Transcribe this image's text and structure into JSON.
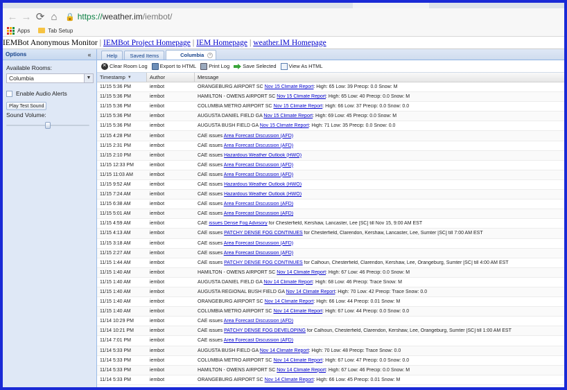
{
  "browser": {
    "url_scheme": "https://",
    "url_host": "weather.im",
    "url_path": "/iembot/",
    "bookmarks": [
      "Apps",
      "Tab Setup"
    ]
  },
  "header": {
    "title": "IEMBot Anonymous Monitor",
    "links": [
      "IEMBot Project Homepage",
      "IEM Homepage",
      "weather.IM Homepage"
    ]
  },
  "options": {
    "title": "Options",
    "rooms_label": "Available Rooms:",
    "selected_room": "Columbia",
    "audio_label": "Enable Audio Alerts",
    "test_sound_label": "Play Test Sound",
    "volume_label": "Sound Volume:",
    "volume_level": 0.5
  },
  "tabs": [
    "Help",
    "Saved Items",
    "Columbia"
  ],
  "actions": {
    "clear": "Clear Room Log",
    "export": "Export to HTML",
    "print": "Print Log",
    "save": "Save Selected",
    "view": "View As HTML"
  },
  "columns": {
    "timestamp": "Timestamp",
    "author": "Author",
    "message": "Message"
  },
  "rows": [
    {
      "ts": "11/15 5:36 PM",
      "author": "iembot",
      "pre": "ORANGEBURG AIRPORT SC ",
      "link": "Nov 15 Climate Report",
      "post": ": High: 65 Low: 39 Precip: 0.0 Snow: M"
    },
    {
      "ts": "11/15 5:36 PM",
      "author": "iembot",
      "pre": "HAMILTON - OWENS AIRPORT SC ",
      "link": "Nov 15 Climate Report",
      "post": ": High: 65 Low: 40 Precip: 0.0 Snow: M"
    },
    {
      "ts": "11/15 5:36 PM",
      "author": "iembot",
      "pre": "COLUMBIA METRO AIRPORT SC ",
      "link": "Nov 15 Climate Report",
      "post": ": High: 66 Low: 37 Precip: 0.0 Snow: 0.0"
    },
    {
      "ts": "11/15 5:36 PM",
      "author": "iembot",
      "pre": "AUGUSTA DANIEL FIELD GA ",
      "link": "Nov 15 Climate Report",
      "post": ": High: 69 Low: 45 Precip: 0.0 Snow: M"
    },
    {
      "ts": "11/15 5:36 PM",
      "author": "iembot",
      "pre": "AUGUSTA BUSH FIELD GA ",
      "link": "Nov 15 Climate Report",
      "post": ": High: 71 Low: 35 Precip: 0.0 Snow: 0.0"
    },
    {
      "ts": "11/15 4:28 PM",
      "author": "iembot",
      "pre": "CAE issues ",
      "link": "Area Forecast Discussion (AFD)",
      "post": ""
    },
    {
      "ts": "11/15 2:31 PM",
      "author": "iembot",
      "pre": "CAE issues ",
      "link": "Area Forecast Discussion (AFD)",
      "post": ""
    },
    {
      "ts": "11/15 2:10 PM",
      "author": "iembot",
      "pre": "CAE issues ",
      "link": "Hazardous Weather Outlook (HWO)",
      "post": ""
    },
    {
      "ts": "11/15 12:33 PM",
      "author": "iembot",
      "pre": "CAE issues ",
      "link": "Area Forecast Discussion (AFD)",
      "post": ""
    },
    {
      "ts": "11/15 11:03 AM",
      "author": "iembot",
      "pre": "CAE issues ",
      "link": "Area Forecast Discussion (AFD)",
      "post": ""
    },
    {
      "ts": "11/15 9:52 AM",
      "author": "iembot",
      "pre": "CAE issues ",
      "link": "Hazardous Weather Outlook (HWO)",
      "post": ""
    },
    {
      "ts": "11/15 7:24 AM",
      "author": "iembot",
      "pre": "CAE issues ",
      "link": "Hazardous Weather Outlook (HWO)",
      "post": ""
    },
    {
      "ts": "11/15 6:38 AM",
      "author": "iembot",
      "pre": "CAE issues ",
      "link": "Area Forecast Discussion (AFD)",
      "post": ""
    },
    {
      "ts": "11/15 5:01 AM",
      "author": "iembot",
      "pre": "CAE issues ",
      "link": "Area Forecast Discussion (AFD)",
      "post": ""
    },
    {
      "ts": "11/15 4:59 AM",
      "author": "iembot",
      "pre": "CAE ",
      "link": "issues Dense Fog Advisory",
      "post": " for Chesterfield, Kershaw, Lancaster, Lee [SC] till Nov 15, 9:00 AM EST"
    },
    {
      "ts": "11/15 4:13 AM",
      "author": "iembot",
      "pre": "CAE issues ",
      "link": "PATCHY DENSE FOG CONTINUES",
      "post": " for Chesterfield, Clarendon, Kershaw, Lancaster, Lee, Sumter [SC] till 7:00 AM EST"
    },
    {
      "ts": "11/15 3:18 AM",
      "author": "iembot",
      "pre": "CAE issues ",
      "link": "Area Forecast Discussion (AFD)",
      "post": ""
    },
    {
      "ts": "11/15 2:27 AM",
      "author": "iembot",
      "pre": "CAE issues ",
      "link": "Area Forecast Discussion (AFD)",
      "post": ""
    },
    {
      "ts": "11/15 1:44 AM",
      "author": "iembot",
      "pre": "CAE issues ",
      "link": "PATCHY DENSE FOG CONTINUES",
      "post": " for Calhoun, Chesterfield, Clarendon, Kershaw, Lee, Orangeburg, Sumter [SC] till 4:00 AM EST"
    },
    {
      "ts": "11/15 1:40 AM",
      "author": "iembot",
      "pre": "HAMILTON - OWENS AIRPORT SC ",
      "link": "Nov 14 Climate Report",
      "post": ": High: 67 Low: 46 Precip: 0.0 Snow: M"
    },
    {
      "ts": "11/15 1:40 AM",
      "author": "iembot",
      "pre": "AUGUSTA DANIEL FIELD GA ",
      "link": "Nov 14 Climate Report",
      "post": ": High: 68 Low: 46 Precip: Trace Snow: M"
    },
    {
      "ts": "11/15 1:40 AM",
      "author": "iembot",
      "pre": "AUGUSTA REGIONAL BUSH FIELD GA ",
      "link": "Nov 14 Climate Report",
      "post": ": High: 70 Low: 42 Precip: Trace Snow: 0.0"
    },
    {
      "ts": "11/15 1:40 AM",
      "author": "iembot",
      "pre": "ORANGEBURG AIRPORT SC ",
      "link": "Nov 14 Climate Report",
      "post": ": High: 66 Low: 44 Precip: 0.01 Snow: M"
    },
    {
      "ts": "11/15 1:40 AM",
      "author": "iembot",
      "pre": "COLUMBIA METRO AIRPORT SC ",
      "link": "Nov 14 Climate Report",
      "post": ": High: 67 Low: 44 Precip: 0.0 Snow: 0.0"
    },
    {
      "ts": "11/14 10:29 PM",
      "author": "iembot",
      "pre": "CAE issues ",
      "link": "Area Forecast Discussion (AFD)",
      "post": ""
    },
    {
      "ts": "11/14 10:21 PM",
      "author": "iembot",
      "pre": "CAE issues ",
      "link": "PATCHY DENSE FOG DEVELOPING",
      "post": " for Calhoun, Chesterfield, Clarendon, Kershaw, Lee, Orangeburg, Sumter [SC] till 1:00 AM EST"
    },
    {
      "ts": "11/14 7:01 PM",
      "author": "iembot",
      "pre": "CAE issues ",
      "link": "Area Forecast Discussion (AFD)",
      "post": ""
    },
    {
      "ts": "11/14 5:33 PM",
      "author": "iembot",
      "pre": "AUGUSTA BUSH FIELD GA ",
      "link": "Nov 14 Climate Report",
      "post": ": High: 70 Low: 48 Precip: Trace Snow: 0.0"
    },
    {
      "ts": "11/14 5:33 PM",
      "author": "iembot",
      "pre": "COLUMBIA METRO AIRPORT SC ",
      "link": "Nov 14 Climate Report",
      "post": ": High: 67 Low: 47 Precip: 0.0 Snow: 0.0"
    },
    {
      "ts": "11/14 5:33 PM",
      "author": "iembot",
      "pre": "HAMILTON - OWENS AIRPORT SC ",
      "link": "Nov 14 Climate Report",
      "post": ": High: 67 Low: 46 Precip: 0.0 Snow: M"
    },
    {
      "ts": "11/14 5:33 PM",
      "author": "iembot",
      "pre": "ORANGEBURG AIRPORT SC ",
      "link": "Nov 14 Climate Report",
      "post": ": High: 66 Low: 45 Precip: 0.01 Snow: M"
    }
  ]
}
